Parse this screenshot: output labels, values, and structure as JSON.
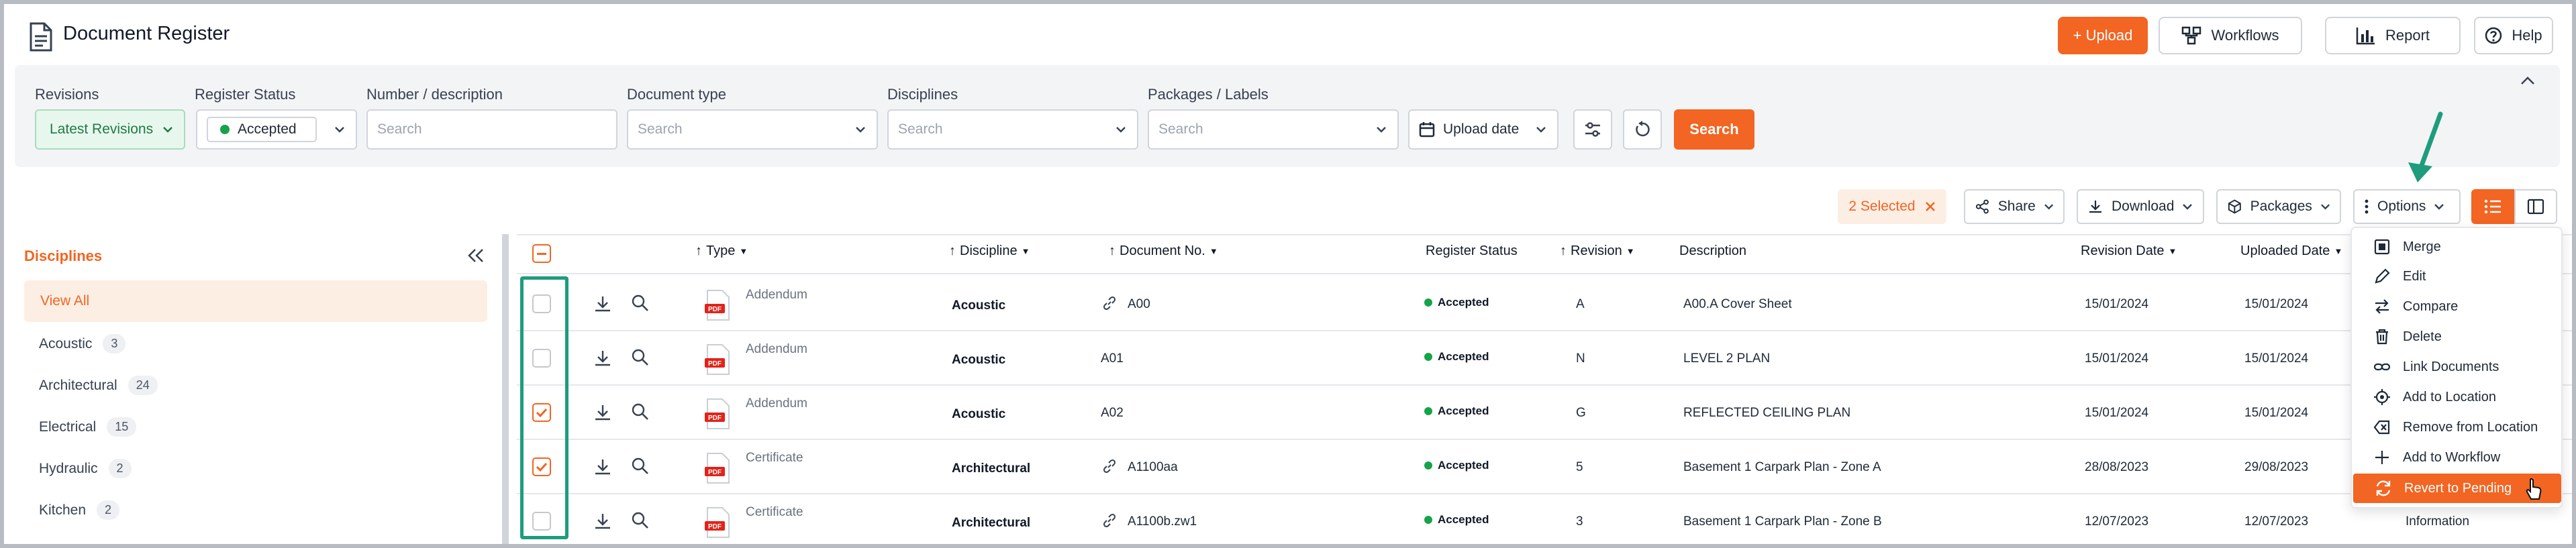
{
  "header": {
    "title": "Document Register",
    "upload_label": "+ Upload",
    "workflows_label": "Workflows",
    "report_label": "Report",
    "help_label": "Help"
  },
  "filters": {
    "revisions_label": "Revisions",
    "revisions_value": "Latest Revisions",
    "register_status_label": "Register Status",
    "register_status_value": "Accepted",
    "number_label": "Number / description",
    "number_placeholder": "Search",
    "doctype_label": "Document type",
    "doctype_placeholder": "Search",
    "disciplines_label": "Disciplines",
    "disciplines_placeholder": "Search",
    "packages_label": "Packages / Labels",
    "packages_placeholder": "Search",
    "upload_date_label": "Upload date",
    "search_label": "Search"
  },
  "toolbar": {
    "selected_label": "2 Selected",
    "share_label": "Share",
    "download_label": "Download",
    "packages_label": "Packages",
    "options_label": "Options"
  },
  "sidebar": {
    "heading": "Disciplines",
    "view_all": "View All",
    "items": [
      {
        "label": "Acoustic",
        "count": "3"
      },
      {
        "label": "Architectural",
        "count": "24"
      },
      {
        "label": "Electrical",
        "count": "15"
      },
      {
        "label": "Hydraulic",
        "count": "2"
      },
      {
        "label": "Kitchen",
        "count": "2"
      }
    ]
  },
  "table": {
    "headers": {
      "type": "Type",
      "discipline": "Discipline",
      "document_no": "Document No.",
      "register_status": "Register Status",
      "revision": "Revision",
      "description": "Description",
      "revision_date": "Revision Date",
      "uploaded_date": "Uploaded Date"
    },
    "rows": [
      {
        "type": "Addendum",
        "discipline": "Acoustic",
        "doc_no": "A00",
        "status": "Accepted",
        "revision": "A",
        "description": "A00.A Cover Sheet",
        "revision_date": "15/01/2024",
        "uploaded_date": "15/01/2024",
        "extra": "",
        "checked": false
      },
      {
        "type": "Addendum",
        "discipline": "Acoustic",
        "doc_no": "A01",
        "status": "Accepted",
        "revision": "N",
        "description": "LEVEL 2 PLAN",
        "revision_date": "15/01/2024",
        "uploaded_date": "15/01/2024",
        "extra": "",
        "checked": false
      },
      {
        "type": "Addendum",
        "discipline": "Acoustic",
        "doc_no": "A02",
        "status": "Accepted",
        "revision": "G",
        "description": "REFLECTED CEILING PLAN",
        "revision_date": "15/01/2024",
        "uploaded_date": "15/01/2024",
        "extra": "",
        "checked": true
      },
      {
        "type": "Certificate",
        "discipline": "Architectural",
        "doc_no": "A1100aa",
        "status": "Accepted",
        "revision": "5",
        "description": "Basement 1 Carpark Plan - Zone A",
        "revision_date": "28/08/2023",
        "uploaded_date": "29/08/2023",
        "extra": "",
        "checked": true
      },
      {
        "type": "Certificate",
        "discipline": "Architectural",
        "doc_no": "A1100b.zw1",
        "status": "Accepted",
        "revision": "3",
        "description": "Basement 1 Carpark Plan - Zone B",
        "revision_date": "12/07/2023",
        "uploaded_date": "12/07/2023",
        "extra": "Information",
        "checked": false
      }
    ]
  },
  "options_menu": {
    "items": [
      "Merge",
      "Edit",
      "Compare",
      "Delete",
      "Link Documents",
      "Add to Location",
      "Remove from Location",
      "Add to Workflow",
      "Revert to Pending"
    ],
    "active": "Revert to Pending"
  },
  "colors": {
    "accent": "#f26522",
    "accepted": "#16a34a",
    "highlight": "#1f9c7c"
  }
}
